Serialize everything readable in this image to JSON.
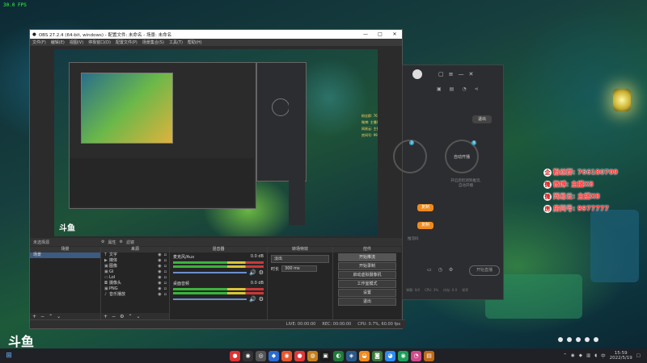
{
  "fps": "30.0 FPS",
  "desktop_logo": "斗鱼",
  "obs": {
    "title": "OBS 27.2.4 (64-bit, windows) - 配置文件: 未命名 - 场景: 未命名",
    "menu": [
      "文件(F)",
      "编辑(E)",
      "视图(V)",
      "停靠窗口(D)",
      "配置文件(P)",
      "场景集合(S)",
      "工具(T)",
      "帮助(H)"
    ],
    "preview_logo": "斗鱼",
    "source_bar_label": "未选择源",
    "source_bar_props": "属性",
    "source_bar_filters": "滤镜",
    "scenes_title": "场景",
    "scenes": [
      "场景"
    ],
    "sources_title": "来源",
    "sources": [
      "文字",
      "媒体",
      "图像",
      "GI",
      "Lol",
      "摄像头",
      "PNG",
      "音乐播放"
    ],
    "mixer_title": "混音器",
    "mixer_tracks": [
      {
        "name": "麦克风/Aux",
        "db": "0.0 dB"
      },
      {
        "name": "桌面音频",
        "db": "0.0 dB"
      }
    ],
    "transition_title": "转场特效",
    "transition_type": "淡出",
    "transition_duration_label": "时长",
    "transition_duration": "300 ms",
    "controls_title": "控件",
    "controls": [
      "开始推流",
      "开始录制",
      "启动虚拟摄像机",
      "工作室模式",
      "设置",
      "退出"
    ],
    "status": {
      "live": "LIVE: 00:00:00",
      "rec": "REC: 00:00:00",
      "cpu": "CPU: 0.7%, 60.00 fps"
    }
  },
  "panel": {
    "exit_label": "退出",
    "circle_left_label": "",
    "circle_right_label": "自动开播",
    "circle_right_sub": "开启后检测到推流,\n自动开播",
    "badge_left": "3",
    "badge_right": "4",
    "button_label": "复制",
    "link_label": "推流码",
    "action_label": "开始直播",
    "stats": [
      "弹幕: 0/0",
      "CPU: 3%",
      "内存: 0.0",
      "帧率"
    ]
  },
  "overlay": [
    {
      "icon": "企",
      "text": "粉丝群:  766180709"
    },
    {
      "icon": "微",
      "text": "微博: 主播X8"
    },
    {
      "icon": "微",
      "text": "网易云: 主播X8"
    },
    {
      "icon": "房",
      "text": "房间号: 9977777"
    }
  ],
  "taskbar": {
    "time": "15:59",
    "date": "2022/5/19"
  },
  "colors": {
    "accent": "#f08a1c",
    "obs_bg": "#2b2b2b",
    "overlay_text": "#ff3a3a"
  }
}
